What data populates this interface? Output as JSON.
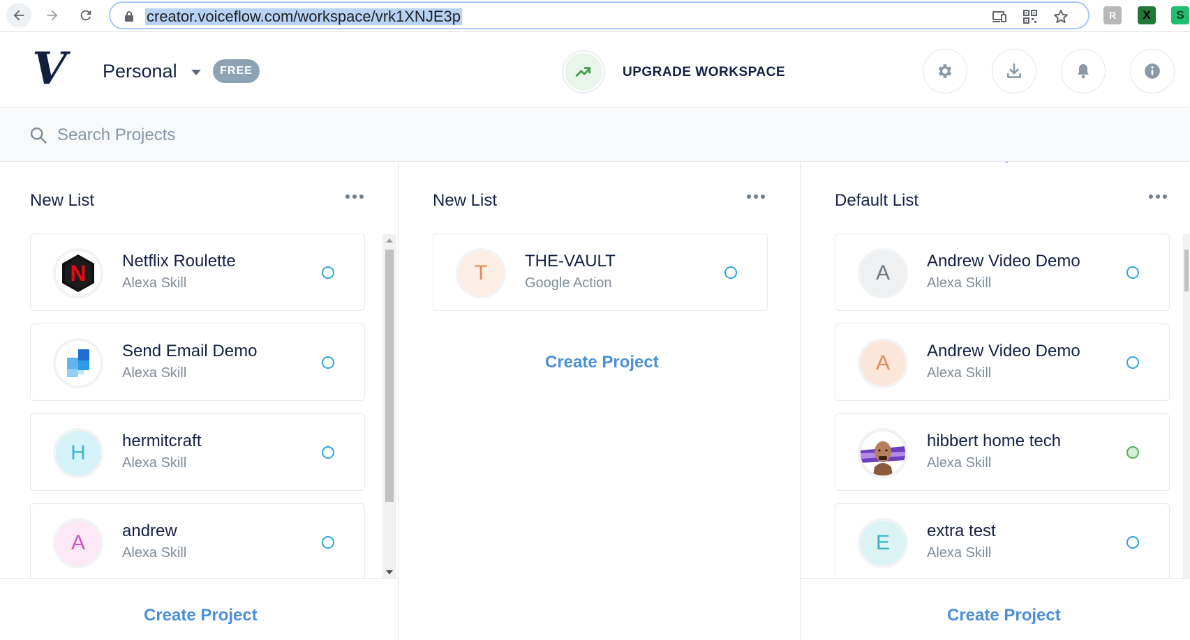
{
  "browser": {
    "url": "creator.voiceflow.com/workspace/vrk1XNJE3p",
    "extensions": [
      "extension-r-icon",
      "extension-x-icon",
      "extension-s-icon"
    ]
  },
  "header": {
    "logo_letter": "V",
    "workspace_name": "Personal",
    "plan_badge": "FREE",
    "upgrade_label": "UPGRADE WORKSPACE",
    "icons": [
      "gear-icon",
      "download-icon",
      "bell-icon",
      "info-icon"
    ]
  },
  "search": {
    "placeholder": "Search Projects",
    "value": ""
  },
  "columns": [
    {
      "title": "New List",
      "projects": [
        {
          "name": "Netflix Roulette",
          "type": "Alexa Skill",
          "avatar": "N",
          "status": "draft"
        },
        {
          "name": "Send Email Demo",
          "type": "Alexa Skill",
          "avatar": "",
          "status": "draft"
        },
        {
          "name": "hermitcraft",
          "type": "Alexa Skill",
          "avatar": "H",
          "status": "draft"
        },
        {
          "name": "andrew",
          "type": "Alexa Skill",
          "avatar": "A",
          "status": "draft"
        }
      ],
      "create_label": "Create Project"
    },
    {
      "title": "New List",
      "projects": [
        {
          "name": "THE-VAULT",
          "type": "Google Action",
          "avatar": "T",
          "status": "draft"
        }
      ],
      "create_label": "Create Project"
    },
    {
      "title": "Default List",
      "projects": [
        {
          "name": "Andrew Video Demo",
          "type": "Alexa Skill",
          "avatar": "A",
          "status": "draft"
        },
        {
          "name": "Andrew Video Demo",
          "type": "Alexa Skill",
          "avatar": "A",
          "status": "draft"
        },
        {
          "name": "hibbert home tech",
          "type": "Alexa Skill",
          "avatar": "",
          "status": "live"
        },
        {
          "name": "extra test",
          "type": "Alexa Skill",
          "avatar": "E",
          "status": "draft"
        }
      ],
      "create_label": "Create Project"
    }
  ],
  "colors": {
    "accent_link": "#4a8fd9",
    "status_draft": "#2ea6d8",
    "status_live": "#5aad5e",
    "plan_badge_bg": "#8da2b5"
  }
}
